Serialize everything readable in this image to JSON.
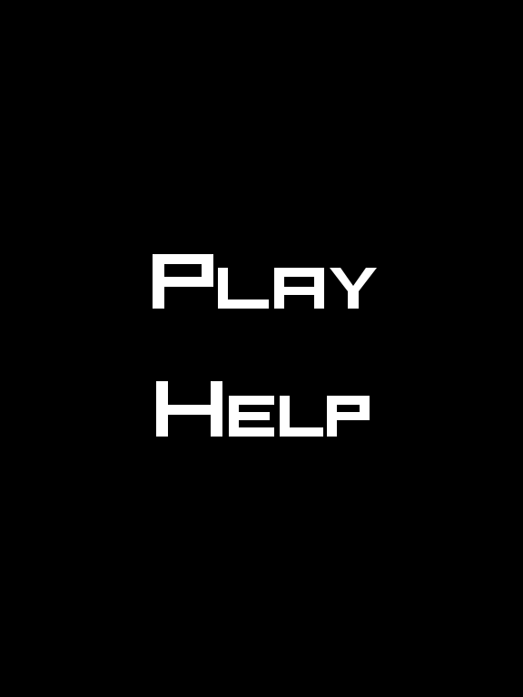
{
  "main_menu": {
    "background_color": "#000000",
    "text_color": "#ffffff",
    "items": [
      {
        "label": "Play"
      },
      {
        "label": "Help"
      }
    ]
  }
}
